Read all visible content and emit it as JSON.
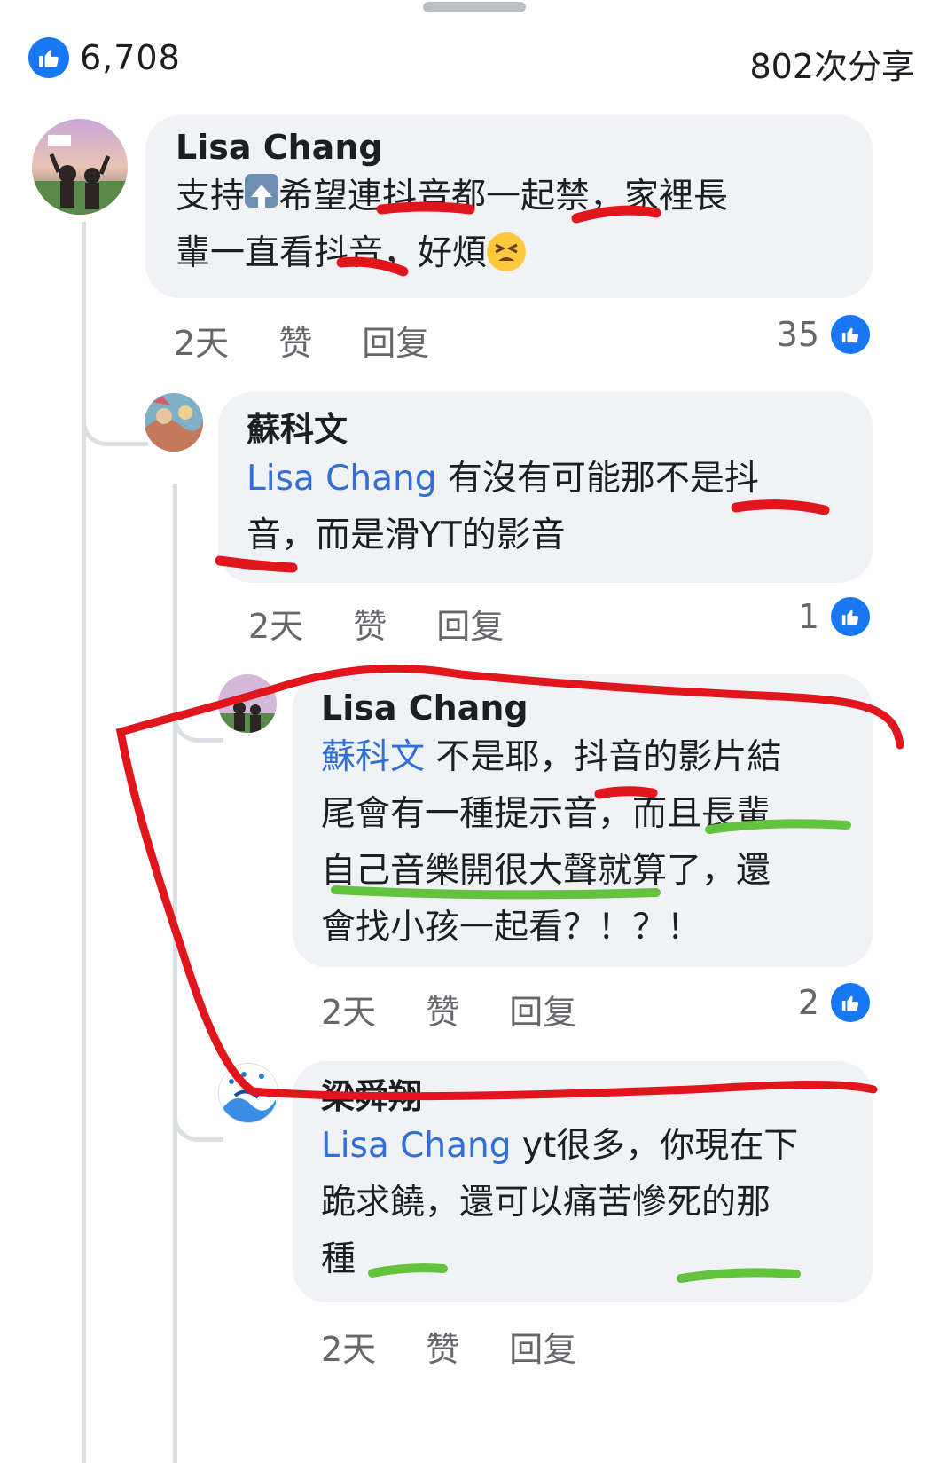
{
  "summary": {
    "likes_count": "6,708",
    "shares": "802次分享"
  },
  "comments": [
    {
      "author": "Lisa Chang",
      "text_a": "支持",
      "text_b": "希望連抖音都一起禁，家裡長",
      "text_c": "輩一直看抖音，好煩",
      "time": "2天",
      "like_label": "赞",
      "reply_label": "回复",
      "reactions": "35"
    },
    {
      "author": "蘇科文",
      "mention": "Lisa Chang",
      "text_a": "有沒有可能那不是抖",
      "text_b": "音，而是滑YT的影音",
      "time": "2天",
      "like_label": "赞",
      "reply_label": "回复",
      "reactions": "1"
    },
    {
      "author": "Lisa Chang",
      "mention": "蘇科文",
      "text_a": "不是耶，抖音的影片結",
      "text_b": "尾會有一種提示音，而且長輩",
      "text_c": "自己音樂開很大聲就算了，還",
      "text_d": "會找小孩一起看？！？！",
      "time": "2天",
      "like_label": "赞",
      "reply_label": "回复",
      "reactions": "2"
    },
    {
      "author": "梁舜翔",
      "mention": "Lisa Chang",
      "text_a": "yt很多，你現在下",
      "text_b": "跪求饒，還可以痛苦慘死的那",
      "text_c": "種",
      "time": "2天",
      "like_label": "赞",
      "reply_label": "回复"
    }
  ],
  "colors": {
    "accent": "#1877f2",
    "mention": "#2f6fd6",
    "bubble": "#f0f2f5",
    "markup_red": "#e0161c",
    "markup_green": "#63c23e"
  }
}
